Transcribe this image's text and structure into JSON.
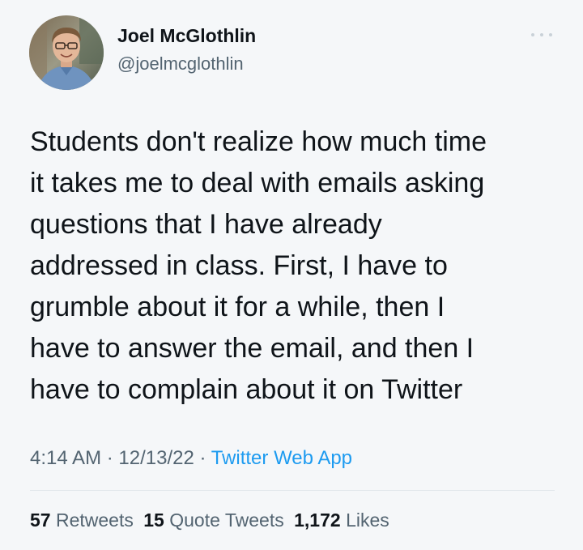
{
  "author": {
    "name": "Joel McGlothlin",
    "handle": "@joelmcglothlin"
  },
  "tweet": {
    "lines": [
      "Students don't realize how much time",
      "it takes me to deal with emails asking",
      "questions that I have already",
      "addressed in class. First, I have to",
      "grumble about it for a while, then I",
      "have to answer the email, and then I",
      "have to complain about it on Twitter"
    ]
  },
  "meta": {
    "time": "4:14 AM",
    "separator1": " · ",
    "date": "12/13/22",
    "separator2": " · ",
    "source": "Twitter Web App"
  },
  "stats": {
    "retweets_count": "57",
    "retweets_label": "Retweets",
    "quotes_count": "15",
    "quotes_label": "Quote Tweets",
    "likes_count": "1,172",
    "likes_label": "Likes"
  },
  "icons": {
    "more": "more-options-icon"
  },
  "colors": {
    "background": "#f5f7f9",
    "text": "#0f1419",
    "secondary": "#536471",
    "link": "#1d9bf0"
  }
}
